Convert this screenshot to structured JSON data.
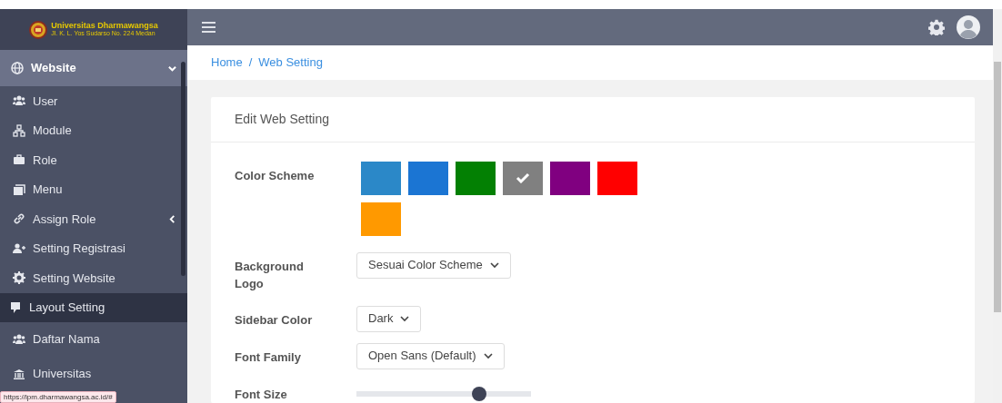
{
  "brand": {
    "name": "Universitas Dharmawangsa",
    "address": "Jl. K. L. Yos Sudarso No. 224 Medan"
  },
  "sidebar": {
    "items": [
      {
        "label": "Website",
        "selected": false,
        "expanded": true
      },
      {
        "label": "User",
        "selected": false
      },
      {
        "label": "Module",
        "selected": false
      },
      {
        "label": "Role",
        "selected": false
      },
      {
        "label": "Menu",
        "selected": false
      },
      {
        "label": "Assign Role",
        "selected": false,
        "expanded": false
      },
      {
        "label": "Setting Registrasi",
        "selected": false
      },
      {
        "label": "Setting Website",
        "selected": false
      },
      {
        "label": "Layout Setting",
        "selected": true
      },
      {
        "label": "Daftar Nama",
        "selected": false
      },
      {
        "label": "Universitas",
        "selected": false
      }
    ]
  },
  "breadcrumb": [
    "Home",
    "Web Setting"
  ],
  "breadcrumb_separator": "/",
  "card": {
    "title": "Edit Web Setting",
    "fields": [
      {
        "kind": "swatches",
        "label": "Color Scheme",
        "swatches": [
          {
            "color": "#2b88c8",
            "selected": false
          },
          {
            "color": "#1b75d3",
            "selected": false
          },
          {
            "color": "#038003",
            "selected": false
          },
          {
            "color": "#808080",
            "selected": true
          },
          {
            "color": "#800080",
            "selected": false
          },
          {
            "color": "#ff0000",
            "selected": false
          },
          {
            "color": "#ff9900",
            "selected": false
          }
        ]
      },
      {
        "kind": "select",
        "label": "Background Logo",
        "value": "Sesuai Color Scheme"
      },
      {
        "kind": "select",
        "label": "Sidebar Color",
        "value": "Dark"
      },
      {
        "kind": "select",
        "label": "Font Family",
        "value": "Open Sans (Default)"
      },
      {
        "kind": "slider",
        "label": "Font Size",
        "level": 0.72
      }
    ]
  },
  "status_link": "https://lpm.dharmawangsa.ac.id/#"
}
